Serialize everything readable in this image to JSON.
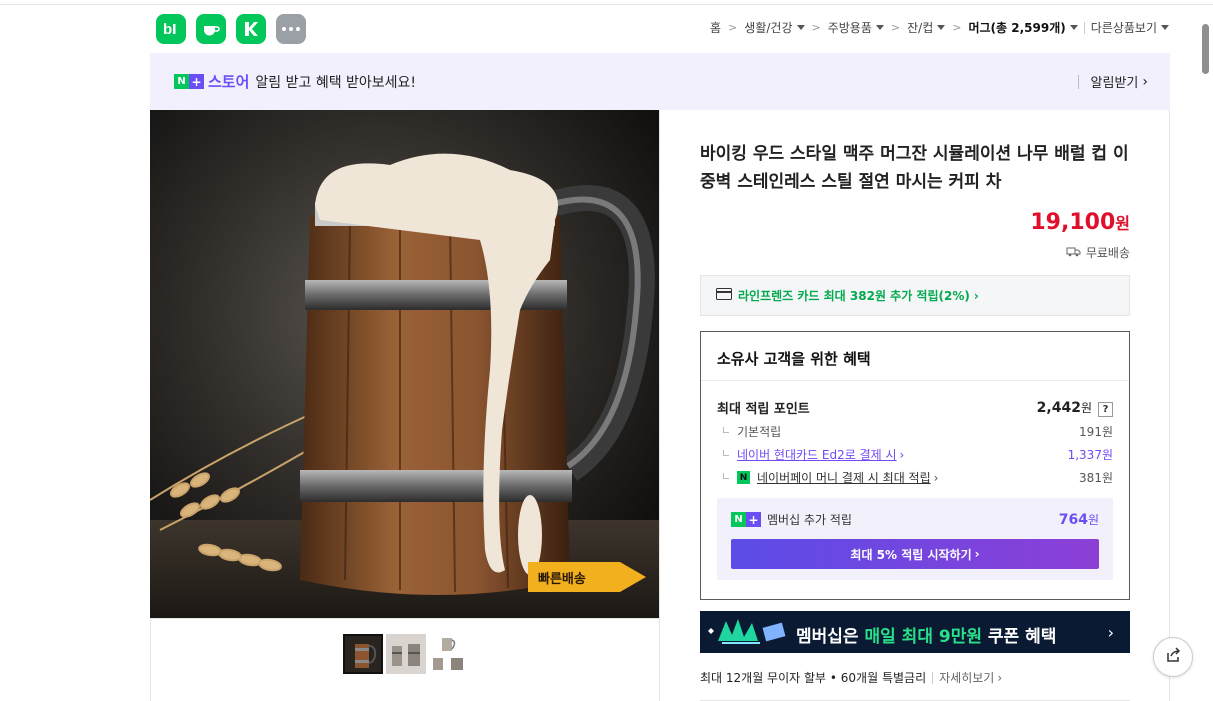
{
  "apps": [
    {
      "icon": "blog-icon"
    },
    {
      "icon": "cafe-icon"
    },
    {
      "icon": "naver-icon"
    },
    {
      "icon": "more-icon"
    }
  ],
  "breadcrumb": {
    "home": "홈",
    "items": [
      "생활/건강",
      "주방용품",
      "잔/컵"
    ],
    "current": "머그(총",
    "current_count": "2,599",
    "current_suffix": "개)",
    "other": "다른상품보기"
  },
  "banner": {
    "badge_n": "N",
    "badge_plus": "+",
    "store": "스토어",
    "text": "알림 받고 혜택 받아보세요!",
    "action": "알림받기"
  },
  "product": {
    "title": "바이킹 우드 스타일 맥주 머그잔 시뮬레이션 나무 배럴 컵 이중벽 스테인레스 스틸 절연 마시는 커피 차",
    "price": "19,100",
    "price_unit": "원",
    "shipping": "무료배송",
    "image_stamp": "빠른배송"
  },
  "card_promo": {
    "text": "라인프렌즈 카드 최대 382원 추가 적립(2%)"
  },
  "benefit": {
    "title": "소유사 고객을 위한 혜택",
    "max_label": "최대 적립 포인트",
    "max_value": "2,442",
    "max_unit": "원",
    "help": "?",
    "rows": [
      {
        "label": "기본적립",
        "value": "191원"
      },
      {
        "label": "네이버 현대카드 Ed2로 결제 시",
        "value": "1,337원"
      },
      {
        "label": "네이버페이 머니 결제 시 최대 적립",
        "value": "381원"
      }
    ],
    "member_label": "멤버십 추가 적립",
    "member_value": "764",
    "member_unit": "원",
    "member_button": "최대 5% 적립 시작하기"
  },
  "membership_banner": {
    "prefix": "멤버십은",
    "highlight": "매일 최대 9만원",
    "suffix": "쿠폰 혜택"
  },
  "installment": {
    "text": "최대 12개월 무이자 할부 • 60개월 특별금리",
    "more": "자세히보기"
  },
  "colors": {
    "naver_green": "#03c75a",
    "store_purple": "#6b4ef6",
    "price_red": "#e0102c"
  }
}
